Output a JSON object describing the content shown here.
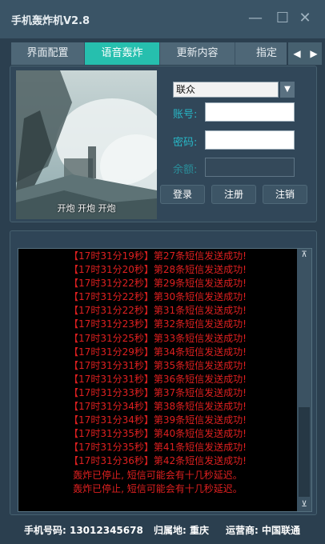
{
  "window": {
    "title": "手机轰炸机V2.8",
    "min_icon": "—",
    "max_icon": "☐",
    "close_icon": "✕"
  },
  "tabs": [
    {
      "label": "界面配置"
    },
    {
      "label": "语音轰炸",
      "active": true
    },
    {
      "label": "更新内容"
    },
    {
      "label": "指定"
    }
  ],
  "tab_scroll": {
    "left": "◀",
    "right": "▶"
  },
  "image": {
    "caption": "开炮  开炮  开炮"
  },
  "account_form": {
    "provider_selected": "联众",
    "account_label": "账号:",
    "password_label": "密码:",
    "balance_label": "余额:",
    "account_value": "",
    "password_value": "",
    "balance_value": ""
  },
  "buttons": {
    "login": "登录",
    "register": "注册",
    "logout": "注销"
  },
  "log": {
    "lines": [
      "【17时31分19秒】第27条短信发送成功!",
      "【17时31分20秒】第28条短信发送成功!",
      "【17时31分22秒】第29条短信发送成功!",
      "【17时31分22秒】第30条短信发送成功!",
      "【17时31分22秒】第31条短信发送成功!",
      "【17时31分23秒】第32条短信发送成功!",
      "【17时31分25秒】第33条短信发送成功!",
      "【17时31分29秒】第34条短信发送成功!",
      "【17时31分31秒】第35条短信发送成功!",
      "【17时31分31秒】第36条短信发送成功!",
      "【17时31分33秒】第37条短信发送成功!",
      "【17时31分34秒】第38条短信发送成功!",
      "【17时31分34秒】第39条短信发送成功!",
      "【17时31分35秒】第40条短信发送成功!",
      "【17时31分35秒】第41条短信发送成功!",
      "【17时31分36秒】第42条短信发送成功!",
      "轰炸已停止, 短信可能会有十几秒延迟。",
      "轰炸已停止, 短信可能会有十几秒延迟。"
    ],
    "scroll_up": "⊼",
    "scroll_down": "⊻"
  },
  "status": {
    "phone": "手机号码: 13012345678",
    "region": "归属地: 重庆",
    "carrier": "运营商: 中国联通"
  },
  "colors": {
    "accent": "#26bfae",
    "log_text": "#e02020",
    "background": "#2b3f4f"
  }
}
